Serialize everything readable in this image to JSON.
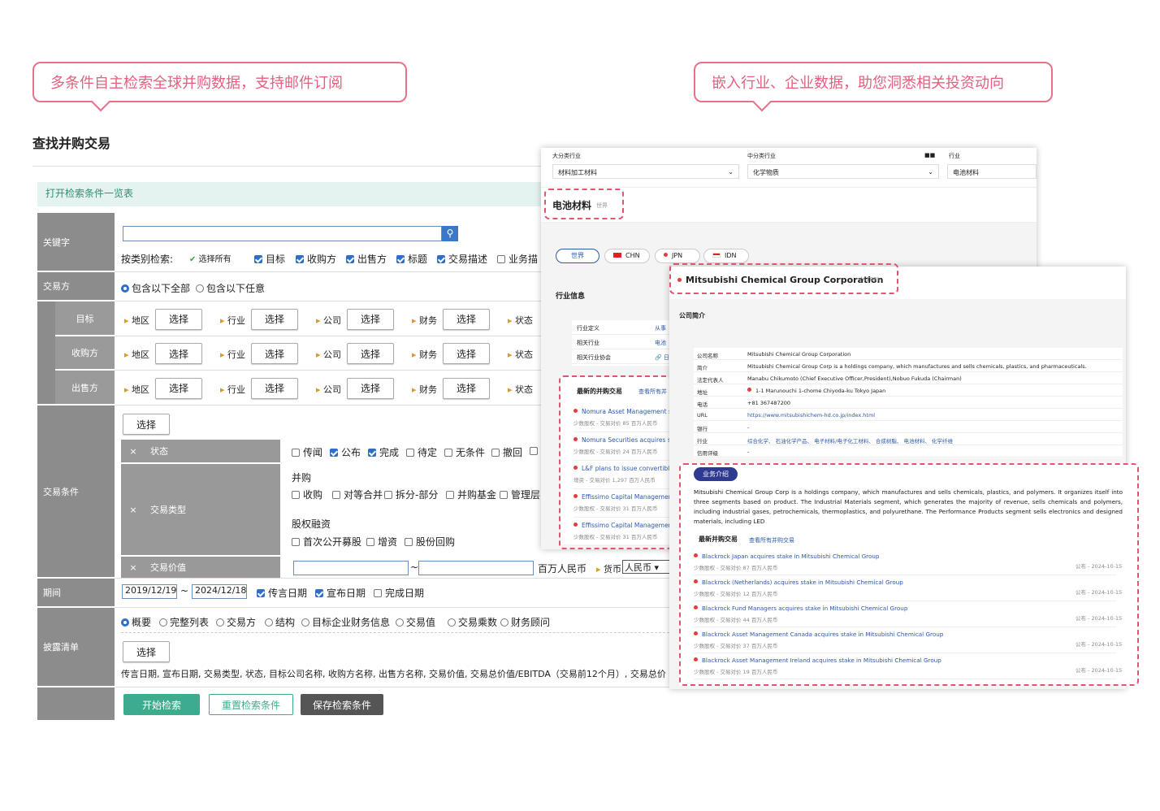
{
  "callouts": {
    "left": "多条件自主检索全球并购数据，支持邮件订阅",
    "right": "嵌入行业、企业数据，助您洞悉相关投资动向"
  },
  "page_title": "查找并购交易",
  "open_list": "打开检索条件一览表",
  "labels": {
    "keyword": "关键字",
    "party": "交易方",
    "target": "目标",
    "acquirer": "收购方",
    "seller": "出售方",
    "conditions": "交易条件",
    "period": "期间",
    "list": "披露清单"
  },
  "search": {
    "by_category": "按类别检索:",
    "select_all": "选择所有",
    "cats": [
      "目标",
      "收购方",
      "出售方",
      "标题",
      "交易描述",
      "业务描"
    ]
  },
  "party_radio": [
    "包含以下全部",
    "包含以下任意"
  ],
  "filters": [
    "地区",
    "行业",
    "公司",
    "财务",
    "状态"
  ],
  "select_btn": "选择",
  "cond": {
    "x": "×",
    "status": "状态",
    "status_items": [
      "传闻",
      "公布",
      "完成",
      "待定",
      "无条件",
      "撤回"
    ],
    "type": "交易类型",
    "ma": "并购",
    "ma_items": [
      "收购",
      "对等合并",
      "拆分-部分",
      "并购基金",
      "管理层"
    ],
    "equity": "股权融资",
    "eq_items": [
      "首次公开募股",
      "增资",
      "股份回购"
    ],
    "value": "交易价值",
    "unit": "百万人民币",
    "currency": "货币",
    "currency_val": "人民币",
    "tilde": "~"
  },
  "period": {
    "from": "2019/12/19",
    "to": "2024/12/18",
    "sep": "~",
    "opts": [
      "传言日期",
      "宣布日期",
      "完成日期"
    ]
  },
  "list": {
    "opts": [
      "概要",
      "完整列表",
      "交易方",
      "结构",
      "目标企业财务信息",
      "交易值",
      "交易乘数",
      "财务顾问"
    ],
    "fields": "传言日期, 宣布日期, 交易类型, 状态, 目标公司名称, 收购方名称, 出售方名称, 交易价值, 交易总价值/EBITDA（交易前12个月）, 交易总价"
  },
  "buttons": {
    "start": "开始检索",
    "reset": "重置检索条件",
    "save": "保存检索条件"
  },
  "industry": {
    "l1": "大分类行业",
    "l1v": "材料加工材料",
    "l2": "中分类行业",
    "l2v": "化学物质",
    "l3": "行业",
    "l3v": "电池材料",
    "mark": "■■",
    "heading": "电池材料",
    "world_tag": "世界",
    "tabs": [
      "世界",
      "CHN",
      "JPN",
      "IDN"
    ],
    "info_title": "行业信息",
    "info_rows": [
      [
        "行业定义",
        "从事"
      ],
      [
        "相关行业",
        "电池"
      ],
      [
        "相关行业协会",
        "🔗 日"
      ]
    ],
    "latest": "最新的并购交易",
    "see_all": "查看所有并",
    "deals": [
      {
        "t": "Nomura Asset Management s",
        "s": "少数股权 - 交易对价 85 百万人民币"
      },
      {
        "t": "Nomura Securities acquires st",
        "s": "少数股权 - 交易对价 24 百万人民币"
      },
      {
        "t": "L&F plans to issue convertible",
        "s": "增资 - 交易对价 1,297 百万人民币"
      },
      {
        "t": "Effissimo Capital Managemen",
        "s": "少数股权 - 交易对价 31 百万人民币"
      },
      {
        "t": "Effissimo Capital Managemen",
        "s": "少数股权 - 交易对价 31 百万人民币"
      }
    ]
  },
  "company": {
    "name": "Mitsubishi Chemical Group Corporation",
    "code": "(4188)",
    "intro": "公司简介",
    "rows": [
      [
        "公司名称",
        "Mitsubishi Chemical Group Corporation"
      ],
      [
        "简介",
        "Mitsubishi Chemical Group Corp is a holdings company, which manufactures and sells chemicals, plastics, and pharmaceuticals."
      ],
      [
        "法定代表人",
        "Manabu Chikumoto (Chief Executive Officer,President),Nobuo Fukuda (Chairman)"
      ],
      [
        "地址",
        "1-1 Marunouchi 1-chome Chiyoda-ku Tokyo Japan"
      ],
      [
        "电话",
        "+81 367487200"
      ],
      [
        "URL",
        "https://www.mitsubishichem-hd.co.jp/index.html"
      ],
      [
        "银行",
        "-"
      ],
      [
        "行业",
        "综合化学、 石油化学产品、 电子材料/电子化工材料、 合成树脂、 电池材料、 化学纤维"
      ],
      [
        "信用评级",
        "-"
      ]
    ],
    "biz_tag": "业务介绍",
    "biz": "Mitsubishi Chemical Group Corp is a holdings company, which manufactures and sells chemicals, plastics, and polymers. It organizes itself into three segments based on product. The Industrial Materials segment, which generates the majority of revenue, sells chemicals and polymers, including industrial gases, petrochemicals, thermoplastics, and polyurethane. The Performance Products segment sells electronics and designed materials, including LED",
    "latest": "最新并购交易",
    "see_all": "查看所有并购交易",
    "deals": [
      {
        "t": "Blackrock Japan acquires stake in Mitsubishi Chemical Group",
        "s": "少数股权 - 交易对价 87 百万人民币",
        "d": "公布 - 2024-10-15"
      },
      {
        "t": "Blackrock (Netherlands) acquires stake in Mitsubishi Chemical Group",
        "s": "少数股权 - 交易对价 12 百万人民币",
        "d": "公布 - 2024-10-15"
      },
      {
        "t": "Blackrock Fund Managers acquires stake in Mitsubishi Chemical Group",
        "s": "少数股权 - 交易对价 44 百万人民币",
        "d": "公布 - 2024-10-15"
      },
      {
        "t": "Blackrock Asset Management Canada acquires stake in Mitsubishi Chemical Group",
        "s": "少数股权 - 交易对价 37 百万人民币",
        "d": "公布 - 2024-10-15"
      },
      {
        "t": "Blackrock Asset Management Ireland acquires stake in Mitsubishi Chemical Group",
        "s": "少数股权 - 交易对价 19 百万人民币",
        "d": "公布 - 2024-10-15"
      }
    ]
  }
}
